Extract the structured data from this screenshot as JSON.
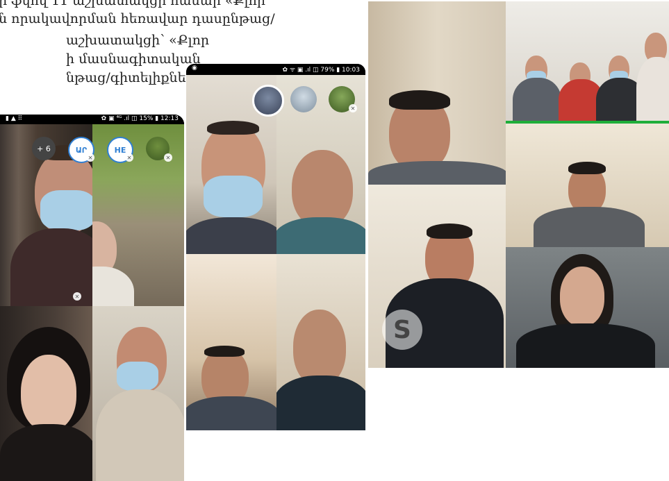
{
  "article": {
    "lines": [
      "ր ֆվով 11 աշխատակցի համար «Քլոր",
      "ն որակավորման հեռավար դասընթաց/",
      "աշխատակցի՝ «Քլոր",
      "ի մասնագիտական",
      "նթաց/գիտելիքների"
    ]
  },
  "phone1": {
    "status_left": "▮ ▲ ⠿",
    "status_right": "✿ ▣ ⁴ᴳ .ıl ◫ 15% ▮ 12:13",
    "participants_more": "+ 6",
    "avatar_1": "ԱՐ",
    "avatar_2": "HE",
    "mic_off_glyph": "✕"
  },
  "phone2": {
    "status_right": "✿ ᯤ ▣ .ıl ◫ 79% ▮ 10:03"
  },
  "skype_window": {
    "logo_letter": "S"
  },
  "colors": {
    "accent_avatar_border": "#2f7fd3",
    "green_call_bar": "#1fae3a"
  }
}
